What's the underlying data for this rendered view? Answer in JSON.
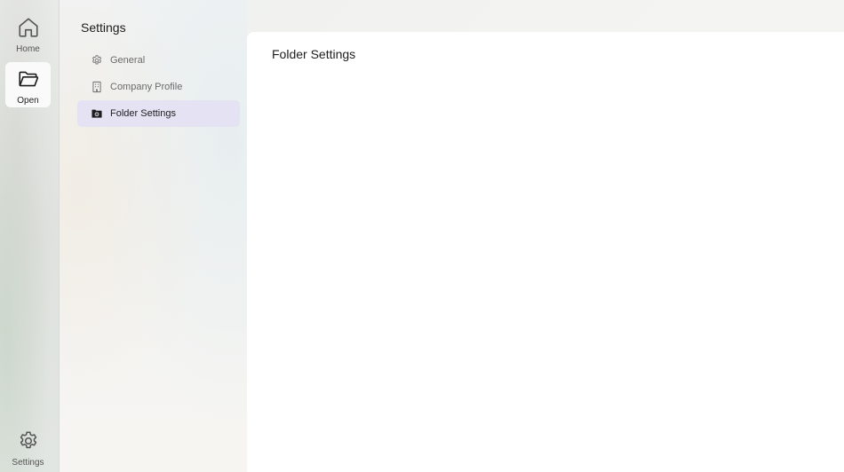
{
  "rail": {
    "items": [
      {
        "label": "Home",
        "icon": "home-icon"
      },
      {
        "label": "Open",
        "icon": "folder-open-icon"
      },
      {
        "label": "Settings",
        "icon": "gear-icon"
      }
    ]
  },
  "settings_nav": {
    "title": "Settings",
    "items": [
      {
        "label": "General",
        "icon": "gear-icon"
      },
      {
        "label": "Company Profile",
        "icon": "building-icon"
      },
      {
        "label": "Folder Settings",
        "icon": "folder-settings-icon"
      }
    ],
    "active_item": "Folder Settings"
  },
  "content": {
    "title": "Folder Settings"
  },
  "colors": {
    "active_nav_background": "#e5e2f4",
    "content_background": "#ffffff"
  }
}
